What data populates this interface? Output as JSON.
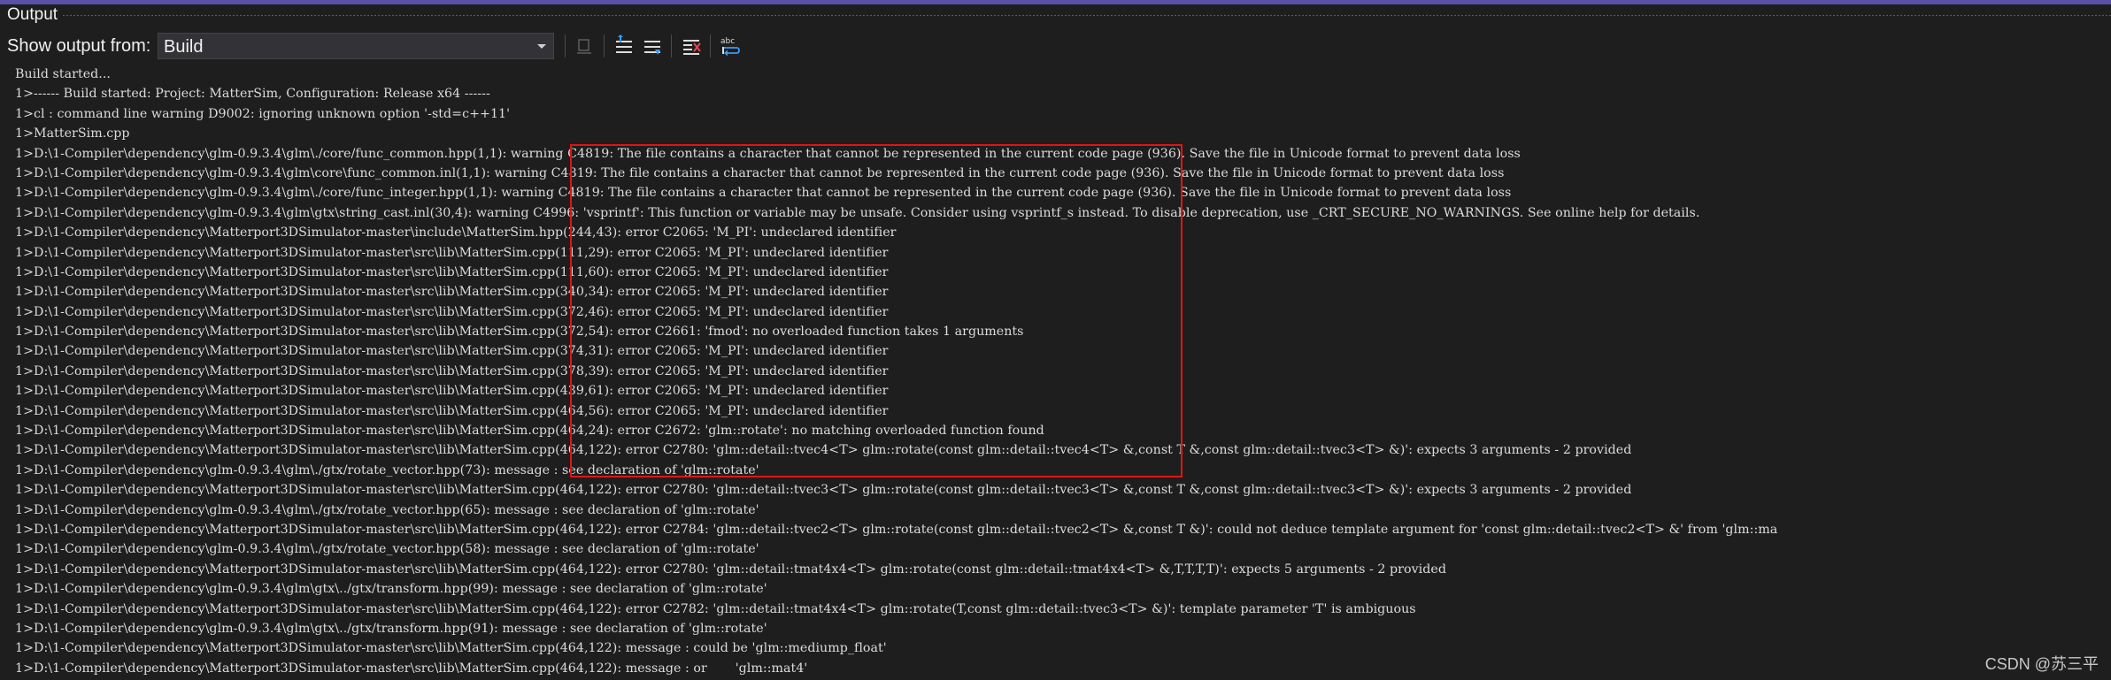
{
  "panel": {
    "title": "Output"
  },
  "toolbar": {
    "show_output_label": "Show output from:",
    "source_value": "Build",
    "buttons": [
      "go-to-previous-message-icon",
      "go-to-next-message-icon",
      "clear-all-icon",
      "toggle-word-wrap-icon"
    ]
  },
  "output": {
    "lines": [
      "Build started...",
      "1>------ Build started: Project: MatterSim, Configuration: Release x64 ------",
      "1>cl : command line warning D9002: ignoring unknown option '-std=c++11'",
      "1>MatterSim.cpp",
      "1>D:\\1-Compiler\\dependency\\glm-0.9.3.4\\glm\\./core/func_common.hpp(1,1): warning C4819: The file contains a character that cannot be represented in the current code page (936). Save the file in Unicode format to prevent data loss",
      "1>D:\\1-Compiler\\dependency\\glm-0.9.3.4\\glm\\core\\func_common.inl(1,1): warning C4819: The file contains a character that cannot be represented in the current code page (936). Save the file in Unicode format to prevent data loss",
      "1>D:\\1-Compiler\\dependency\\glm-0.9.3.4\\glm\\./core/func_integer.hpp(1,1): warning C4819: The file contains a character that cannot be represented in the current code page (936). Save the file in Unicode format to prevent data loss",
      "1>D:\\1-Compiler\\dependency\\glm-0.9.3.4\\glm\\gtx\\string_cast.inl(30,4): warning C4996: 'vsprintf': This function or variable may be unsafe. Consider using vsprintf_s instead. To disable deprecation, use _CRT_SECURE_NO_WARNINGS. See online help for details.",
      "1>D:\\1-Compiler\\dependency\\Matterport3DSimulator-master\\include\\MatterSim.hpp(244,43): error C2065: 'M_PI': undeclared identifier",
      "1>D:\\1-Compiler\\dependency\\Matterport3DSimulator-master\\src\\lib\\MatterSim.cpp(111,29): error C2065: 'M_PI': undeclared identifier",
      "1>D:\\1-Compiler\\dependency\\Matterport3DSimulator-master\\src\\lib\\MatterSim.cpp(111,60): error C2065: 'M_PI': undeclared identifier",
      "1>D:\\1-Compiler\\dependency\\Matterport3DSimulator-master\\src\\lib\\MatterSim.cpp(340,34): error C2065: 'M_PI': undeclared identifier",
      "1>D:\\1-Compiler\\dependency\\Matterport3DSimulator-master\\src\\lib\\MatterSim.cpp(372,46): error C2065: 'M_PI': undeclared identifier",
      "1>D:\\1-Compiler\\dependency\\Matterport3DSimulator-master\\src\\lib\\MatterSim.cpp(372,54): error C2661: 'fmod': no overloaded function takes 1 arguments",
      "1>D:\\1-Compiler\\dependency\\Matterport3DSimulator-master\\src\\lib\\MatterSim.cpp(374,31): error C2065: 'M_PI': undeclared identifier",
      "1>D:\\1-Compiler\\dependency\\Matterport3DSimulator-master\\src\\lib\\MatterSim.cpp(378,39): error C2065: 'M_PI': undeclared identifier",
      "1>D:\\1-Compiler\\dependency\\Matterport3DSimulator-master\\src\\lib\\MatterSim.cpp(439,61): error C2065: 'M_PI': undeclared identifier",
      "1>D:\\1-Compiler\\dependency\\Matterport3DSimulator-master\\src\\lib\\MatterSim.cpp(464,56): error C2065: 'M_PI': undeclared identifier",
      "1>D:\\1-Compiler\\dependency\\Matterport3DSimulator-master\\src\\lib\\MatterSim.cpp(464,24): error C2672: 'glm::rotate': no matching overloaded function found",
      "1>D:\\1-Compiler\\dependency\\Matterport3DSimulator-master\\src\\lib\\MatterSim.cpp(464,122): error C2780: 'glm::detail::tvec4<T> glm::rotate(const glm::detail::tvec4<T> &,const T &,const glm::detail::tvec3<T> &)': expects 3 arguments - 2 provided",
      "1>D:\\1-Compiler\\dependency\\glm-0.9.3.4\\glm\\./gtx/rotate_vector.hpp(73): message : see declaration of 'glm::rotate'",
      "1>D:\\1-Compiler\\dependency\\Matterport3DSimulator-master\\src\\lib\\MatterSim.cpp(464,122): error C2780: 'glm::detail::tvec3<T> glm::rotate(const glm::detail::tvec3<T> &,const T &,const glm::detail::tvec3<T> &)': expects 3 arguments - 2 provided",
      "1>D:\\1-Compiler\\dependency\\glm-0.9.3.4\\glm\\./gtx/rotate_vector.hpp(65): message : see declaration of 'glm::rotate'",
      "1>D:\\1-Compiler\\dependency\\Matterport3DSimulator-master\\src\\lib\\MatterSim.cpp(464,122): error C2784: 'glm::detail::tvec2<T> glm::rotate(const glm::detail::tvec2<T> &,const T &)': could not deduce template argument for 'const glm::detail::tvec2<T> &' from 'glm::ma",
      "1>D:\\1-Compiler\\dependency\\glm-0.9.3.4\\glm\\./gtx/rotate_vector.hpp(58): message : see declaration of 'glm::rotate'",
      "1>D:\\1-Compiler\\dependency\\Matterport3DSimulator-master\\src\\lib\\MatterSim.cpp(464,122): error C2780: 'glm::detail::tmat4x4<T> glm::rotate(const glm::detail::tmat4x4<T> &,T,T,T,T)': expects 5 arguments - 2 provided",
      "1>D:\\1-Compiler\\dependency\\glm-0.9.3.4\\glm\\gtx\\../gtx/transform.hpp(99): message : see declaration of 'glm::rotate'",
      "1>D:\\1-Compiler\\dependency\\Matterport3DSimulator-master\\src\\lib\\MatterSim.cpp(464,122): error C2782: 'glm::detail::tmat4x4<T> glm::rotate(T,const glm::detail::tvec3<T> &)': template parameter 'T' is ambiguous",
      "1>D:\\1-Compiler\\dependency\\glm-0.9.3.4\\glm\\gtx\\../gtx/transform.hpp(91): message : see declaration of 'glm::rotate'",
      "1>D:\\1-Compiler\\dependency\\Matterport3DSimulator-master\\src\\lib\\MatterSim.cpp(464,122): message : could be 'glm::mediump_float'",
      "1>D:\\1-Compiler\\dependency\\Matterport3DSimulator-master\\src\\lib\\MatterSim.cpp(464,122): message : or       'glm::mat4'"
    ]
  },
  "watermark": "CSDN @苏三平",
  "colors": {
    "accent": "#5b50a8",
    "background": "#1e1e1e",
    "text": "#dcdcdc",
    "annotation_box": "#e01515"
  }
}
